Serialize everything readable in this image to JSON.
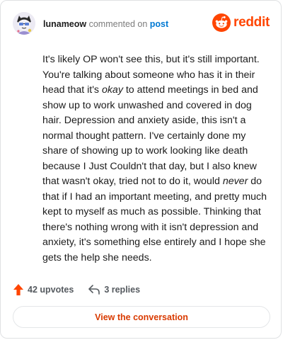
{
  "comment": {
    "username": "lunameow",
    "action_text": "commented on",
    "post_link_label": "post",
    "body": {
      "p1": "It's likely OP won't see this, but it's still important. You're talking about someone who has it in their head that it's ",
      "p2_em": "okay",
      "p3": " to attend meetings in bed and show up to work unwashed and covered in dog hair. Depression and anxiety aside, this isn't a normal thought pattern. I've certainly done my share of showing up to work looking like death because I Just Couldn't that day, but I also knew that wasn't okay, tried not to do it, would ",
      "p4_em": "never",
      "p5": " do that if I had an important meeting, and pretty much kept to myself as much as possible. Thinking that there's nothing wrong with it isn't depression and anxiety, it's something else entirely and I hope she gets the help she needs."
    },
    "upvotes": "42 upvotes",
    "replies": "3 replies"
  },
  "brand": {
    "wordmark": "reddit",
    "icon": "reddit-snoo-icon",
    "color": "#ff4500"
  },
  "actions": {
    "view_conversation": "View the conversation"
  },
  "icons": {
    "upvote": "upvote-arrow-icon",
    "reply": "reply-arrow-icon",
    "avatar": "user-avatar"
  },
  "colors": {
    "accent": "#ff4500",
    "link": "#0079d3",
    "button_text": "#d93a00"
  }
}
